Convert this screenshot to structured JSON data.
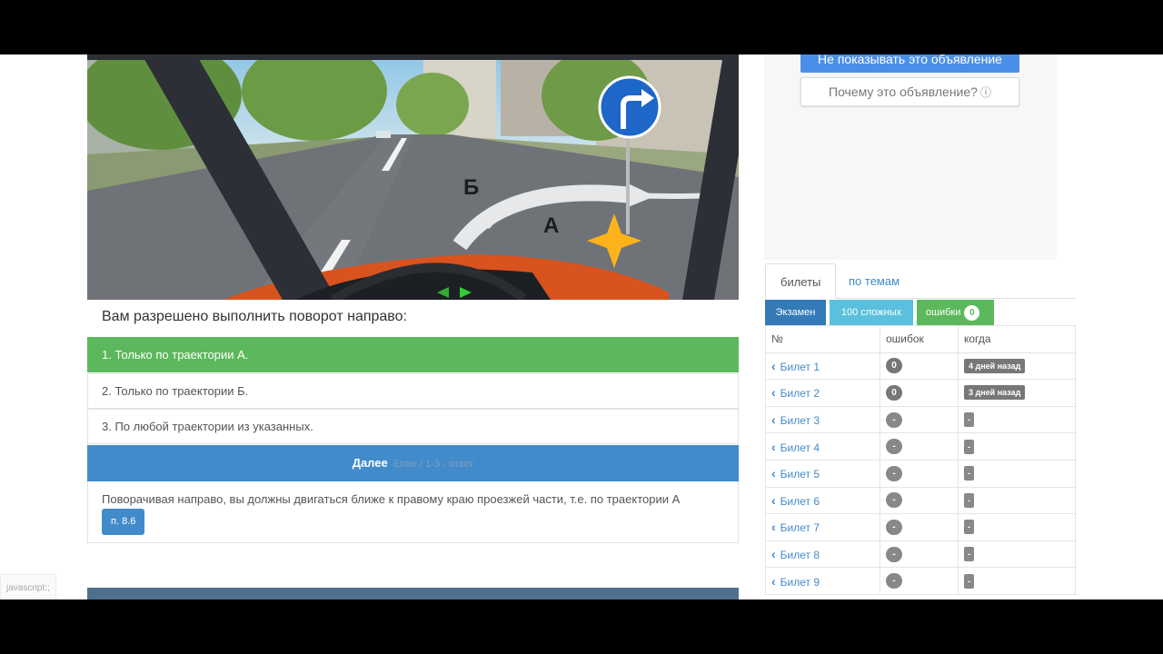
{
  "question": {
    "sign_letters": {
      "b": "Б",
      "a": "А"
    },
    "text": "Вам разрешено выполнить поворот направо:",
    "answers": [
      {
        "label": "1. Только по траектории А.",
        "correct": true
      },
      {
        "label": "2. Только по траектории Б.",
        "correct": false
      },
      {
        "label": "3. По любой траектории из указанных.",
        "correct": false
      }
    ],
    "next_label": "Далее",
    "next_hint": "Enter / 1-3 - ответ",
    "explanation": "Поворачивая направо, вы должны двигаться ближе к правому краю проезжей части, т.е. по траектории А",
    "rule_badge": "п. 8.6"
  },
  "status_tip": "javascript:;",
  "ad": {
    "hide_label": "Не показывать это объявление",
    "why_label": "Почему это объявление?",
    "why_icon": "ⓘ"
  },
  "tabs": {
    "tickets": "билеты",
    "topics": "по темам"
  },
  "filters": {
    "exam": "Экзамен",
    "hard": "100 сложных",
    "errors": "ошибки",
    "errors_count": "0"
  },
  "table": {
    "headers": [
      "№",
      "ошибок",
      "когда"
    ],
    "rows": [
      {
        "ticket": "Билет 1",
        "errors": "0",
        "when": "4 дней назад"
      },
      {
        "ticket": "Билет 2",
        "errors": "0",
        "when": "3 дней назад"
      },
      {
        "ticket": "Билет 3",
        "errors": "-",
        "when": "-"
      },
      {
        "ticket": "Билет 4",
        "errors": "-",
        "when": "-"
      },
      {
        "ticket": "Билет 5",
        "errors": "-",
        "when": "-"
      },
      {
        "ticket": "Билет 6",
        "errors": "-",
        "when": "-"
      },
      {
        "ticket": "Билет 7",
        "errors": "-",
        "when": "-"
      },
      {
        "ticket": "Билет 8",
        "errors": "-",
        "when": "-"
      },
      {
        "ticket": "Билет 9",
        "errors": "-",
        "when": "-"
      }
    ]
  },
  "colors": {
    "primary": "#428bca",
    "success": "#5cb85c",
    "info": "#5bc0de",
    "dark": "#337ab7"
  }
}
